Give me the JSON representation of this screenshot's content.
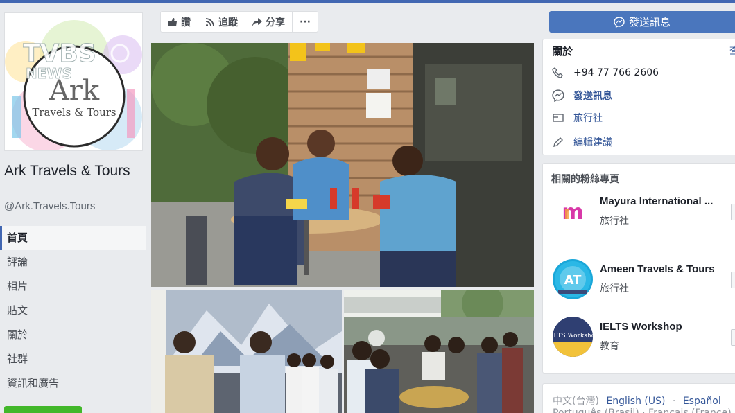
{
  "page": {
    "name": "Ark Travels & Tours",
    "handle": "@Ark.Travels.Tours",
    "logo_text": "Ark",
    "logo_subtext": "Travels & Tours",
    "watermark": "TVBS NEWS"
  },
  "nav": {
    "items": [
      "首頁",
      "評論",
      "相片",
      "貼文",
      "關於",
      "社群",
      "資訊和廣告"
    ],
    "active_index": 0
  },
  "actions": {
    "like_label": "讚",
    "follow_label": "追蹤",
    "share_label": "分享",
    "more_label": "···",
    "send_message_label": "發送訊息"
  },
  "about": {
    "title": "關於",
    "see_all": "查",
    "phone": "+94 77 766 2606",
    "message_label": "發送訊息",
    "category": "旅行社",
    "suggest_edits": "編輯建議"
  },
  "related": {
    "title": "相關的粉絲專頁",
    "items": [
      {
        "name": "Mayura International ...",
        "category": "旅行社",
        "logo_text": "m"
      },
      {
        "name": "Ameen Travels & Tours",
        "category": "旅行社",
        "logo_text": "AT"
      },
      {
        "name": "IELTS Workshop",
        "category": "教育",
        "logo_text": "IELTS Workshop"
      }
    ]
  },
  "languages": {
    "current": "中文(台灣)",
    "options": [
      "English (US)",
      "Español"
    ],
    "second_line": "Português (Brasil) · Français (France)"
  },
  "colors": {
    "brand_blue": "#4267b2",
    "send_button": "#4a76bd",
    "link": "#365899"
  }
}
